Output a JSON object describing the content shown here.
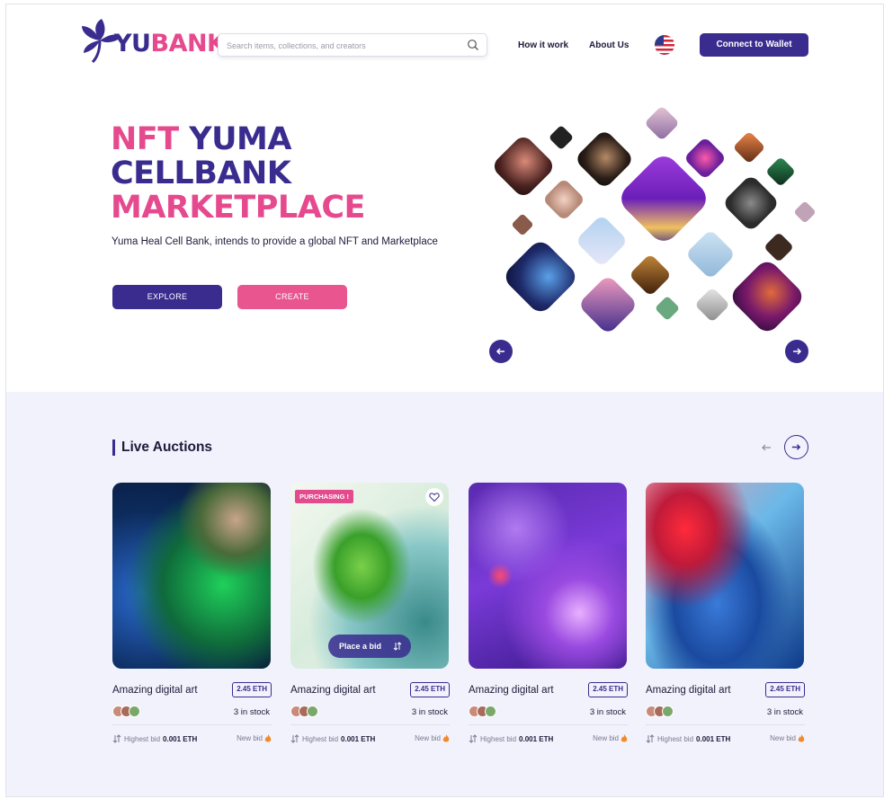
{
  "brand": {
    "logo_y": "YU",
    "logo_b": "BANK"
  },
  "search": {
    "placeholder": "Search items, collections, and creators"
  },
  "nav": {
    "how_it_works": "How it work",
    "about": "About Us",
    "flag_icon": "us-flag-icon"
  },
  "header": {
    "connect_wallet": "Connect to Wallet"
  },
  "hero": {
    "title_line1_a": "NFT",
    "title_line1_b": "YUMA",
    "title_line2": "CELLBANK",
    "title_line3": "MARKETPLACE",
    "subtitle": "Yuma Heal Cell Bank, intends to provide a global NFT and Marketplace",
    "explore": "EXPLORE",
    "create": "CREATE"
  },
  "auctions": {
    "title": "Live Auctions",
    "cards": [
      {
        "name": "Amazing digital art",
        "price": "2.45 ETH",
        "stock": "3 in stock",
        "highest_bid_label": "Highest bid",
        "highest_bid_value": "0.001 ETH",
        "new_bid": "New bid"
      },
      {
        "name": "Amazing digital art",
        "price": "2.45 ETH",
        "stock": "3 in stock",
        "highest_bid_label": "Highest bid",
        "highest_bid_value": "0.001 ETH",
        "new_bid": "New bid",
        "badge": "PURCHASING !",
        "place_bid": "Place a bid"
      },
      {
        "name": "Amazing digital art",
        "price": "2.45 ETH",
        "stock": "3 in stock",
        "highest_bid_label": "Highest bid",
        "highest_bid_value": "0.001 ETH",
        "new_bid": "New bid"
      },
      {
        "name": "Amazing digital art",
        "price": "2.45 ETH",
        "stock": "3 in stock",
        "highest_bid_label": "Highest bid",
        "highest_bid_value": "0.001 ETH",
        "new_bid": "New bid"
      }
    ]
  },
  "colors": {
    "primary": "#3a2c8f",
    "accent": "#e64a8e",
    "section_bg": "#f1f2fb"
  }
}
